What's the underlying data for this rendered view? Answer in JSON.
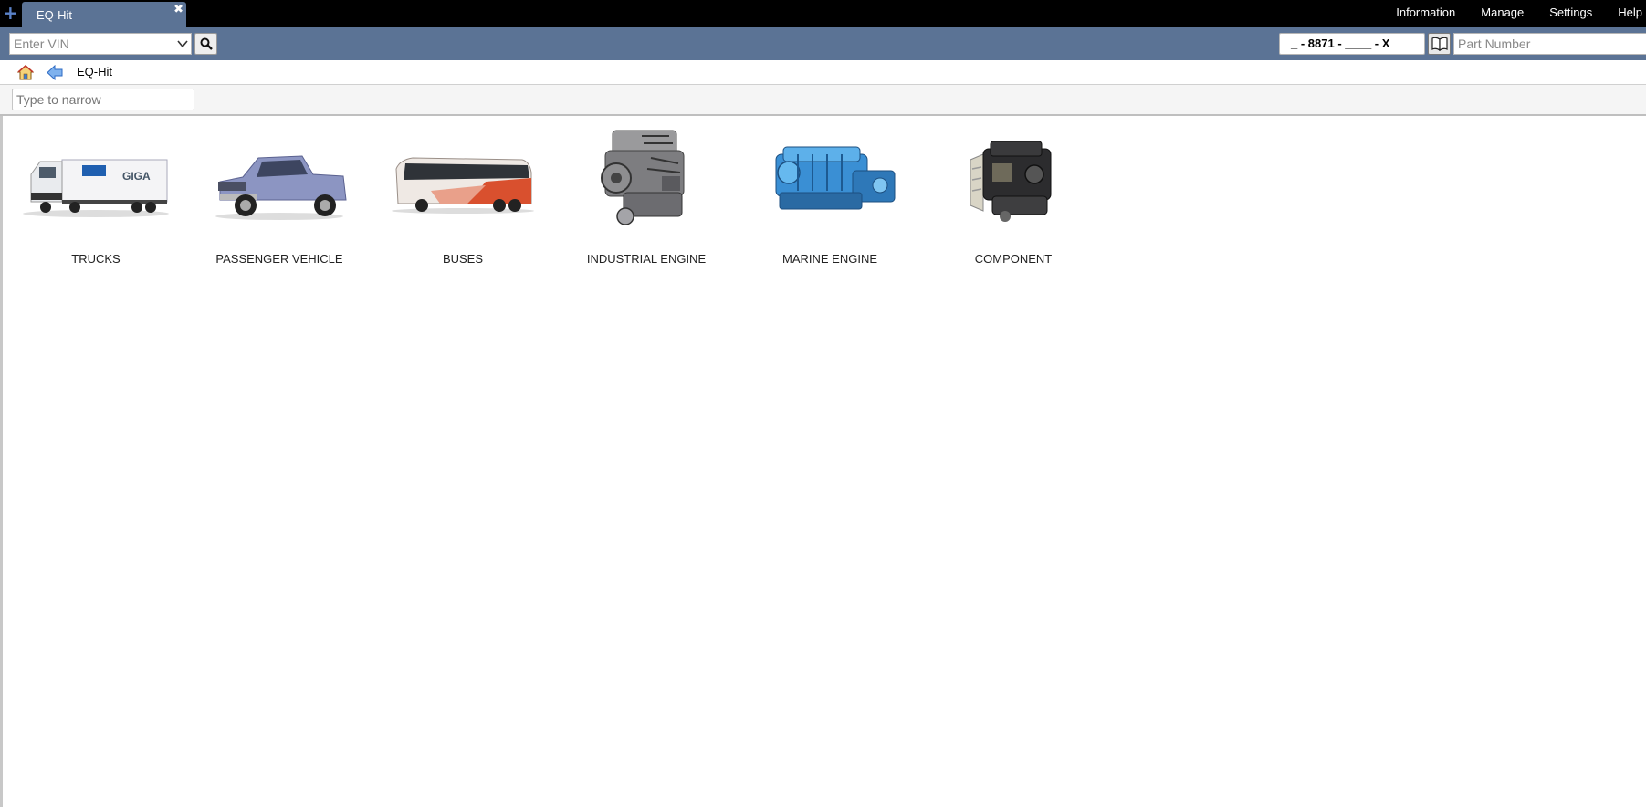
{
  "tabs": {
    "new_tab_glyph": "+",
    "active_tab_label": "EQ-Hit",
    "close_glyph": "✖"
  },
  "top_menu": [
    "Information",
    "Manage",
    "Settings",
    "Help"
  ],
  "toolbar": {
    "vin_placeholder": "Enter VIN",
    "part_mask": "_ - 8871 - ____ - X",
    "part_number_placeholder": "Part Number"
  },
  "breadcrumb": {
    "current": "EQ-Hit"
  },
  "filter": {
    "placeholder": "Type to narrow"
  },
  "categories": [
    {
      "label": "TRUCKS",
      "icon": "truck-image"
    },
    {
      "label": "PASSENGER VEHICLE",
      "icon": "pickup-image"
    },
    {
      "label": "BUSES",
      "icon": "bus-image"
    },
    {
      "label": "INDUSTRIAL ENGINE",
      "icon": "industrial-engine-image"
    },
    {
      "label": "MARINE ENGINE",
      "icon": "marine-engine-image"
    },
    {
      "label": "COMPONENT",
      "icon": "component-engine-image"
    }
  ],
  "colors": {
    "toolbar": "#5b7395",
    "topbar": "#000000",
    "accent_plus": "#5a82c8"
  }
}
